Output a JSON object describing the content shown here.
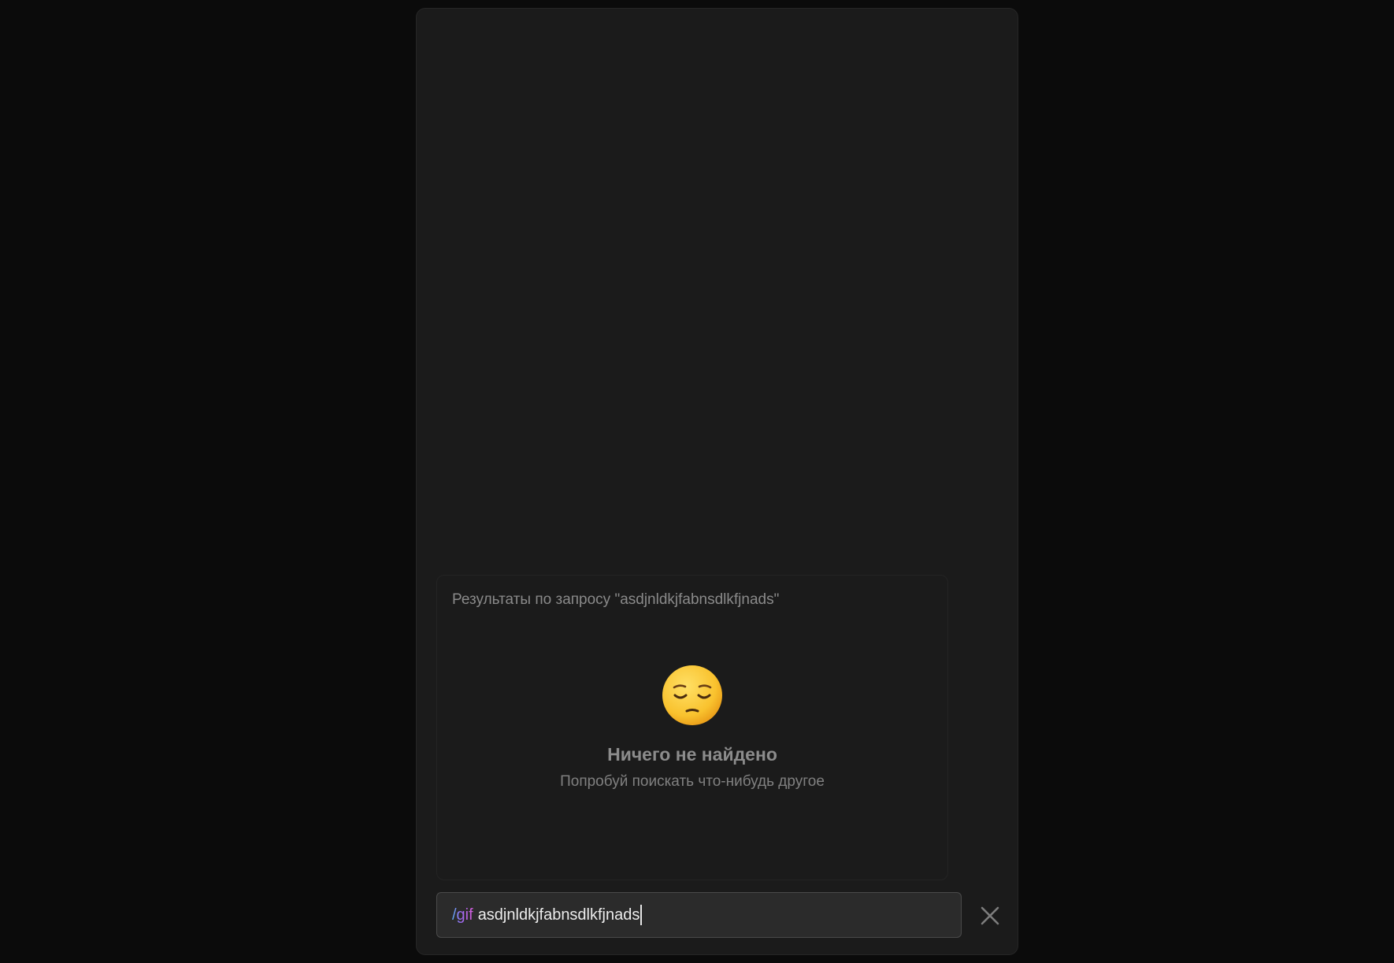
{
  "results": {
    "title": "Результаты по запросу \"asdjnldkjfabnsdlkfjnads\""
  },
  "empty_state": {
    "icon": "pensive-face-emoji",
    "title": "Ничего не найдено",
    "subtitle": "Попробуй поискать что-нибудь другое"
  },
  "input": {
    "command": "/gif",
    "query": "asdjnldkjfabnsdlkfjnads"
  },
  "icons": {
    "close": "close-icon"
  },
  "colors": {
    "background": "#0b0b0b",
    "panel": "#1b1b1b",
    "input_bg": "#2b2b2b",
    "command_gradient_start": "#5aa9f0",
    "command_gradient_end": "#d65ad8"
  }
}
